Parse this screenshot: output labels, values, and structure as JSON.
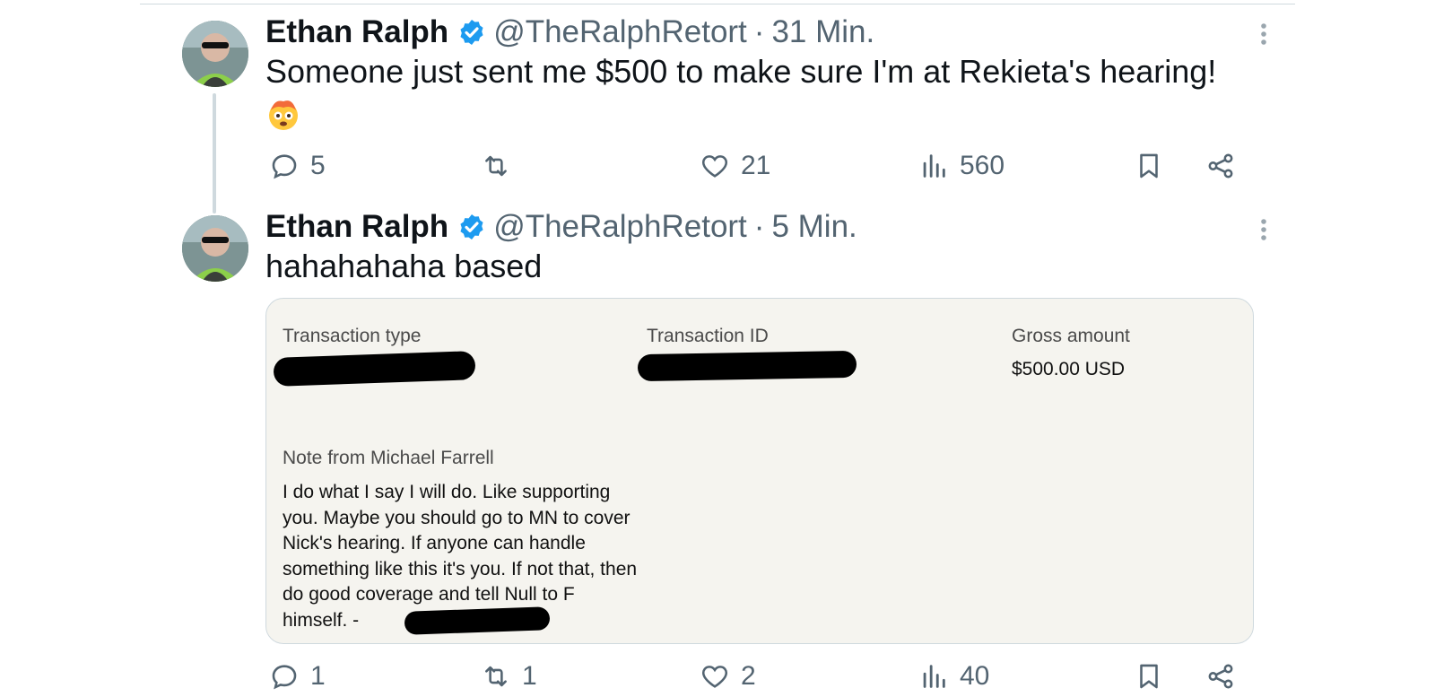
{
  "tweets": [
    {
      "author": "Ethan Ralph",
      "handle": "@TheRalphRetort",
      "separator": "·",
      "time": "31 Min.",
      "text": "Someone just sent me $500 to make sure I'm at Rekieta's hearing!",
      "emoji": "flushed-exploding-head-emoji",
      "stats": {
        "replies": "5",
        "retweets": "",
        "likes": "21",
        "views": "560"
      }
    },
    {
      "author": "Ethan Ralph",
      "handle": "@TheRalphRetort",
      "separator": "·",
      "time": "5 Min.",
      "text": "hahahahaha based",
      "stats": {
        "replies": "1",
        "retweets": "1",
        "likes": "2",
        "views": "40"
      }
    }
  ],
  "transaction": {
    "type_label": "Transaction type",
    "id_label": "Transaction ID",
    "amount_label": "Gross amount",
    "amount_value": "$500.00 USD",
    "note_label": "Note from Michael Farrell",
    "note_text": "I do what I say I will do. Like supporting you. Maybe you should go to MN to cover Nick's hearing. If anyone can handle something like this it's you. If not that, then do good coverage and tell Null to F himself. -"
  },
  "colors": {
    "verified": "#1d9bf0",
    "muted": "#536471",
    "card_bg": "#f5f4ef",
    "border": "#cfd9de"
  }
}
